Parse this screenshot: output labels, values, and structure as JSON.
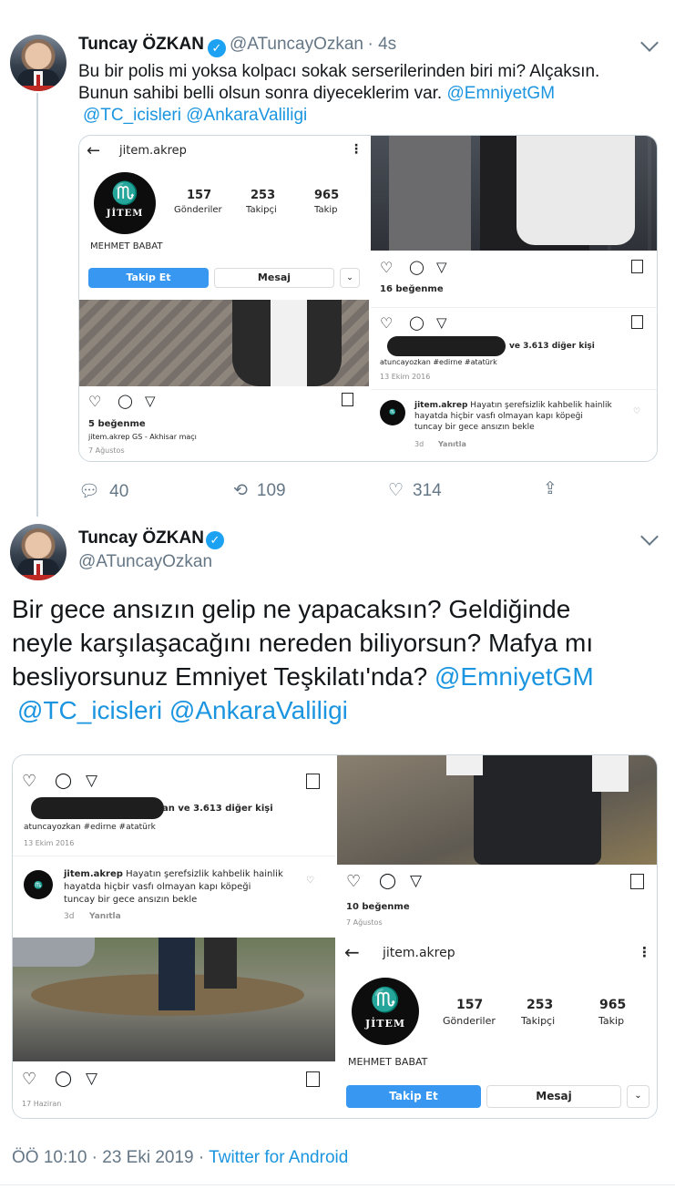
{
  "tweet1": {
    "name": "Tuncay ÖZKAN",
    "handle": "@ATuncayOzkan",
    "time": "· 4s",
    "text_line1": "Bu bir polis mi yoksa kolpacı sokak serserilerinden biri mi? Alçaksın.",
    "text_line2": "Bunun sahibi belli olsun sonra diyeceklerim var.",
    "mention1": "@EmniyetGM",
    "mention2": "@TC_icisleri",
    "mention3": "@AnkaraValiligi",
    "reply_count": "40",
    "retweet_count": "109",
    "like_count": "314"
  },
  "tweet2": {
    "name": "Tuncay ÖZKAN",
    "handle": "@ATuncayOzkan",
    "text_line1": "Bir gece ansızın gelip ne yapacaksın? Geldiğinde",
    "text_line2": "neyle karşılaşacağını nereden biliyorsun? Mafya mı",
    "text_line3": "besliyorsunuz Emniyet Teşkilatı'nda?",
    "mention1": "@EmniyetGM",
    "mention2": "@TC_icisleri",
    "mention3": "@AnkaraValiligi",
    "timestamp": "ÖÖ 10:10 · 23 Eki 2019 ·",
    "source": "Twitter for Android"
  },
  "instagram": {
    "username": "jitem.akrep",
    "posts_count": "157",
    "posts_label": "Gönderiler",
    "followers_count": "253",
    "followers_label": "Takipçi",
    "following_count": "965",
    "following_label": "Takip",
    "display_name": "MEHMET BABAT",
    "follow_button": "Takip Et",
    "message_button": "Mesaj",
    "logo_text": "JİTEM",
    "likes_5": "5 beğenme",
    "caption_5": "jitem.akrep GS - Akhisar maçı",
    "date_aug7": "7 Ağustos",
    "likes_16": "16 beğenme",
    "likes_others": "an ve 3.613 diğer kişi",
    "likes_others_right": "ve 3.613 diğer kişi",
    "caption_edirne": "atuncayozkan #edirne #atatürk",
    "date_oct13": "13 Ekim 2016",
    "comment_user": "jitem.akrep",
    "comment_line1": "Hayatın şerefsizlik kahbelik hainlik",
    "comment_line2": "hayatda hiçbir vasfı olmayan kapı köpeği",
    "comment_line3": "tuncay bir gece ansızın bekle",
    "comment_age": "3d",
    "comment_reply": "Yanıtla",
    "likes_10": "10 beğenme",
    "date_jun17": "17 Haziran"
  },
  "colors": {
    "link": "#1b95e0",
    "verified": "#1da1f2",
    "instagram_blue": "#3897f0",
    "text_gray": "#657786"
  },
  "icons": [
    "verified-badge-icon",
    "chevron-down-icon",
    "reply-icon",
    "retweet-icon",
    "like-icon",
    "share-icon",
    "heart-outline-icon",
    "comment-icon",
    "send-icon",
    "bookmark-icon",
    "back-arrow-icon",
    "more-vertical-icon",
    "scorpion-logo"
  ]
}
